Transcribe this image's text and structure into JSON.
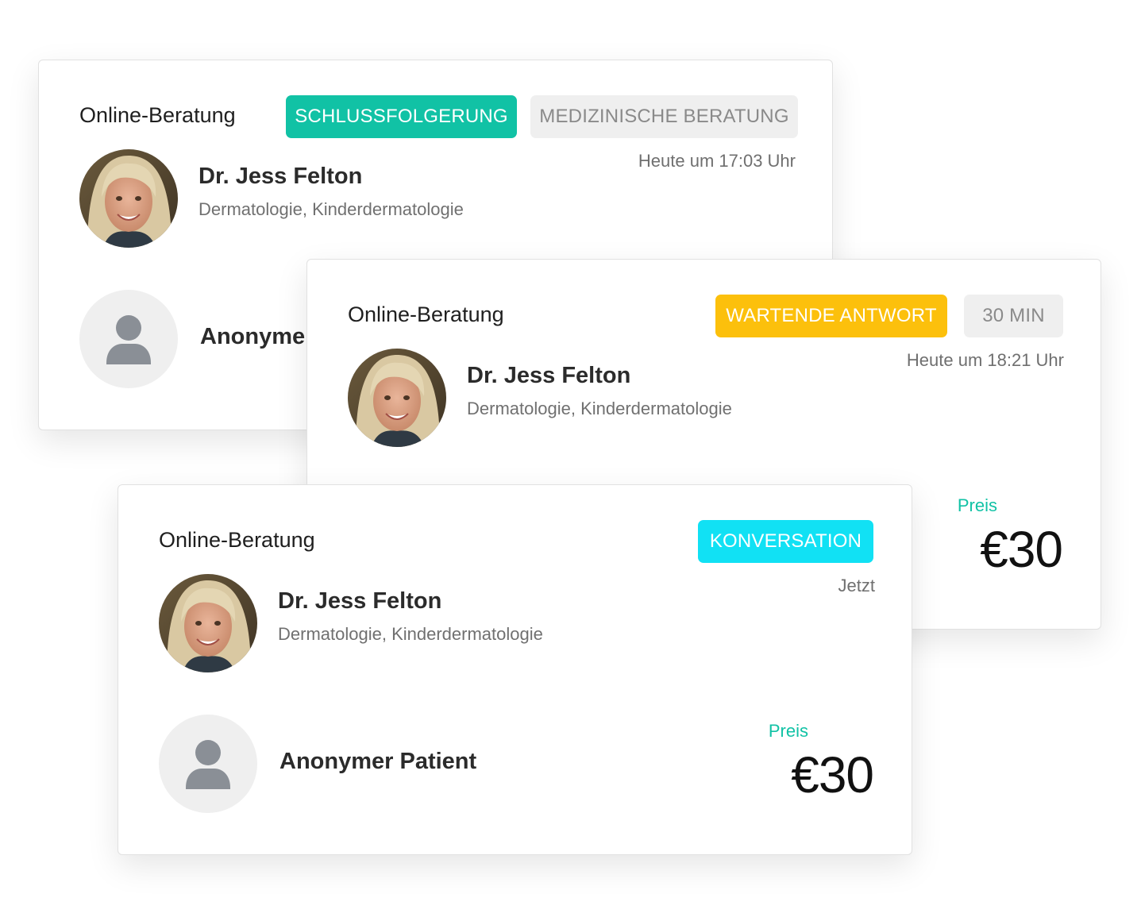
{
  "colors": {
    "teal": "#11c2a5",
    "yellow": "#fcc00c",
    "cyan": "#11e1f4",
    "gray_badge": "#efefef"
  },
  "cards": [
    {
      "title": "Online-Beratung",
      "badges": [
        "SCHLUSSFOLGERUNG",
        "MEDIZINISCHE BERATUNG"
      ],
      "time": "Heute um 17:03 Uhr",
      "doctor": {
        "name": "Dr. Jess Felton",
        "specialty": "Dermatologie, Kinderdermatologie",
        "avatar_icon": "doctor-photo"
      },
      "patient": {
        "name": "Anonymer Patient",
        "avatar_icon": "user-icon"
      }
    },
    {
      "title": "Online-Beratung",
      "badges": [
        "WARTENDE ANTWORT",
        "30 MIN"
      ],
      "time": "Heute um 18:21 Uhr",
      "doctor": {
        "name": "Dr. Jess Felton",
        "specialty": "Dermatologie, Kinderdermatologie",
        "avatar_icon": "doctor-photo"
      },
      "price": {
        "label": "Preis",
        "value": "€30"
      }
    },
    {
      "title": "Online-Beratung",
      "badges": [
        "KONVERSATION"
      ],
      "time": "Jetzt",
      "doctor": {
        "name": "Dr. Jess Felton",
        "specialty": "Dermatologie, Kinderdermatologie",
        "avatar_icon": "doctor-photo"
      },
      "patient": {
        "name": "Anonymer Patient",
        "avatar_icon": "user-icon"
      },
      "price": {
        "label": "Preis",
        "value": "€30"
      }
    }
  ]
}
